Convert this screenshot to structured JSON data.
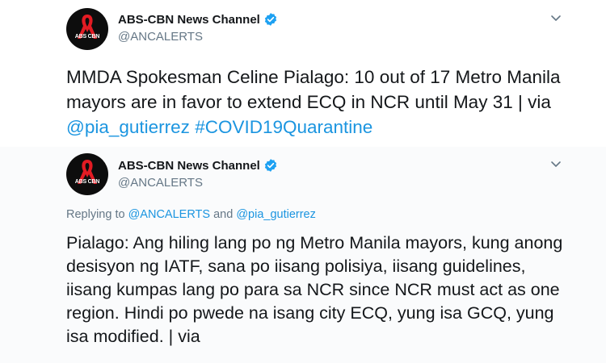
{
  "tweets": [
    {
      "display_name": "ABS-CBN News Channel",
      "handle": "@ANCALERTS",
      "avatar_logo_text": "ABS CBN",
      "body": {
        "text": "MMDA Spokesman Celine Pialago: 10 out of 17 Metro Manila mayors are in favor to extend ECQ in NCR until May 31 | via ",
        "mention": "@pia_gutierrez",
        "hashtag": "#COVID19Quarantine"
      }
    },
    {
      "display_name": "ABS-CBN News Channel",
      "handle": "@ANCALERTS",
      "avatar_logo_text": "ABS CBN",
      "reply": {
        "prefix": "Replying to ",
        "mention_1": "@ANCALERTS",
        "joiner": " and ",
        "mention_2": "@pia_gutierrez"
      },
      "body": {
        "text": "Pialago: Ang hiling lang po ng Metro Manila mayors, kung anong desisyon ng IATF, sana po iisang polisiya, iisang guidelines, iisang kumpas lang po para sa NCR since NCR must act as one region. Hindi po pwede na isang city ECQ, yung isa GCQ, yung isa modified. | via"
      }
    }
  ],
  "colors": {
    "link": "#1b95e0",
    "verified": "#1da1f2",
    "secondary_text": "#657786",
    "primary_text": "#14171a"
  },
  "icons": {
    "verified": "verified-badge-icon",
    "caret": "chevron-down-icon",
    "avatar": "abs-cbn-logo"
  }
}
